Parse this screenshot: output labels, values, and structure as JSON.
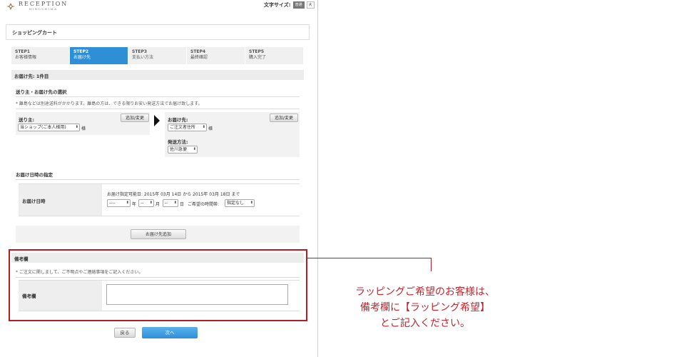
{
  "header": {
    "brand": "RECEPTION",
    "brand_sub": "HIROSHIMA",
    "font_size_label": "文字サイズ:",
    "font_size_options": [
      "普通",
      "大"
    ]
  },
  "cart_title": "ショッピングカート",
  "steps": [
    {
      "num": "STEP1",
      "label": "お客様情報",
      "active": false
    },
    {
      "num": "STEP2",
      "label": "お届け先",
      "active": true
    },
    {
      "num": "STEP3",
      "label": "支払い方法",
      "active": false
    },
    {
      "num": "STEP4",
      "label": "最終確認",
      "active": false
    },
    {
      "num": "STEP5",
      "label": "購入完了",
      "active": false
    }
  ],
  "delivery_count": "お届け先: 1件目",
  "sender_section": {
    "title": "送り主・お届け先の選択",
    "note": "* 離島などは別途送料がかかります。離島の方は、できる限りお安い発送方法でお届け致します。",
    "sender_label": "送り主:",
    "sender_select": "当ショップ(ご本人様用)",
    "sama": "様",
    "add_change": "追加/変更",
    "recipient_label": "お届け先:",
    "recipient_select": "ご注文者住所",
    "shipping_label": "発送方法:",
    "shipping_select": "佐川急便"
  },
  "datetime_section": {
    "title": "お届け日時の指定",
    "row_label": "お届け日時",
    "range_text": "お届け指定可能日: 2015年 03月 14日 から 2015年 03月 18日 まで",
    "year_select": "----",
    "year_unit": "年",
    "month_select": "--",
    "month_unit": "月",
    "day_select": "--",
    "day_unit": "日",
    "time_label": "ご希望の時間帯:",
    "time_select": "指定なし"
  },
  "add_delivery_button": "お届け先追加",
  "remarks_section": {
    "title": "備考欄",
    "note": "* ご注文に関しまして、ご不明点やご連絡事項をご記入ください。",
    "row_label": "備考欄"
  },
  "buttons": {
    "back": "戻る",
    "next": "次へ"
  },
  "callout": {
    "line1": "ラッピングご希望のお客様は、",
    "line2": "備考欄に【ラッピング希望】",
    "line3": "とご記入ください。"
  },
  "colors": {
    "accent_blue": "#2f8fd6",
    "callout_red": "#b71c23"
  }
}
